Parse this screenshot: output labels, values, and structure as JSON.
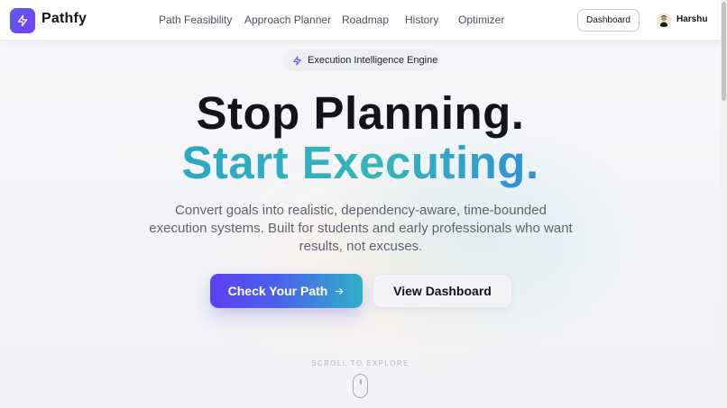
{
  "brand": {
    "name": "Pathfy",
    "logo_icon": "lightning-icon",
    "accent": "#5b5cf0"
  },
  "nav": {
    "items": [
      {
        "label": "Path Feasibility"
      },
      {
        "label": "Approach Planner"
      },
      {
        "label": "Roadmap"
      },
      {
        "label": "History"
      },
      {
        "label": "Optimizer"
      }
    ],
    "dashboard_button": "Dashboard",
    "user_name": "Harshu"
  },
  "hero": {
    "badge_text": "Execution Intelligence Engine",
    "badge_icon": "lightning-icon",
    "headline_line1": "Stop Planning.",
    "headline_line2": "Start Executing.",
    "subtitle": "Convert goals into realistic, dependency-aware, time-bounded execution systems. Built for students and early professionals who want results, not excuses.",
    "primary_button": "Check Your Path",
    "primary_button_icon": "arrow-right-icon",
    "secondary_button": "View Dashboard",
    "scroll_hint": "SCROLL TO EXPLORE"
  },
  "colors": {
    "gradient_start": "#5b3ff0",
    "gradient_end": "#2fb0c8",
    "headline_accent": "#34b6b9"
  }
}
